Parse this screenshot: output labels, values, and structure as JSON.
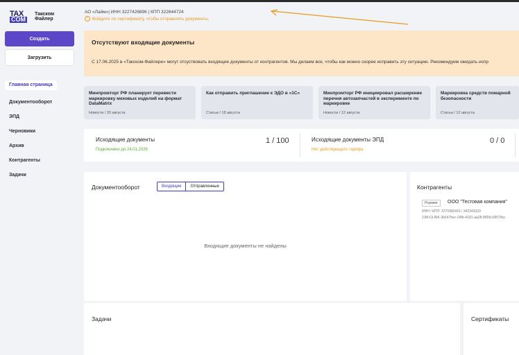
{
  "logo": {
    "mark_top": "TAX",
    "mark_bottom": "COM",
    "line1": "Такском",
    "line2": "Файлер"
  },
  "sidebar": {
    "create_label": "Создать",
    "upload_label": "Загрузить",
    "items": [
      {
        "label": "Главная страница"
      },
      {
        "label": "Документооборот"
      },
      {
        "label": "ЭПД"
      },
      {
        "label": "Черновики"
      },
      {
        "label": "Архив"
      },
      {
        "label": "Контрагенты"
      },
      {
        "label": "Задачи"
      }
    ]
  },
  "header": {
    "org": "АО «Лайм»| ИНН 3227426896 | КПП 322644724",
    "cert_link": "Войдите по сертификату, чтобы отправлять документы."
  },
  "alert": {
    "title": "Отсутствуют входящие документы",
    "text": "С 17.06.2025 в «Такском-Файлере» могут отсуствовать входящие документы от контрагентов. Мы делаем все, чтобы как можно скорее исправить эту ситуацию. Рекомендуем ожидать испр"
  },
  "news": [
    {
      "title": "Минпромторг РФ планирует перевести маркировку меховых изделий на формат DataMatrix",
      "meta": "Новости / 20 августа"
    },
    {
      "title": "Как отправить приглашение к ЭДО в «1С»",
      "meta": "Статьи / 18 августа"
    },
    {
      "title": "Минпромторг РФ инициировал расширение перечня автозапчастей в эксперименте по маркировке",
      "meta": "Новости / 12 августа"
    },
    {
      "title": "Маркировка средств пожарной безопасности",
      "meta": "Статьи / 12 августа"
    }
  ],
  "stats": {
    "outgoing_title": "Исходящие документы",
    "outgoing_sub": "Подключено до 24.01.2026",
    "outgoing_value": "1 / 100",
    "epd_title": "Исходящие документы ЭПД",
    "epd_sub": "Нет действующего тарифа",
    "epd_value": "0 / 0"
  },
  "docflow": {
    "title": "Документооборот",
    "tab_in": "Входящие",
    "tab_out": "Отправленные",
    "empty": "Входящие документы не найдены"
  },
  "counterparties": {
    "title": "Контрагенты",
    "badge": "Роуминг",
    "name": "ООО \"Тестовая компания\"",
    "meta": "ИНН / КПП:    1279360416 / 342343333",
    "id": "2JM-DLINK-3b547bec-24fb-4181-aa28-8656c09578cc"
  },
  "tasks": {
    "title": "Задачи"
  },
  "certs": {
    "title": "Сертификаты"
  },
  "colors": {
    "accent": "#5b47c8",
    "warning_bg": "#fde5c8",
    "link_orange": "#e79a1d",
    "success_green": "#5aa832"
  }
}
